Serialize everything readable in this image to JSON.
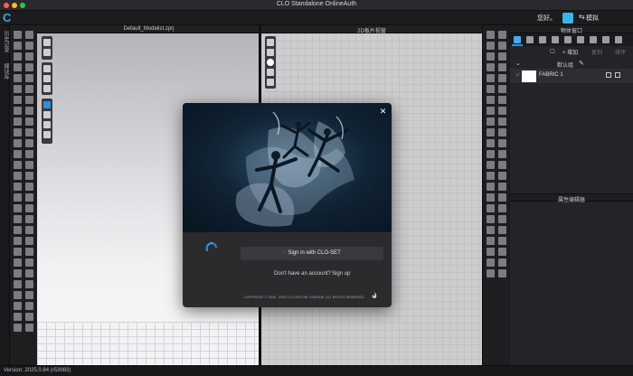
{
  "window": {
    "title": "CLO Standalone OnlineAuth"
  },
  "menubar": {
    "greeting": "您好。",
    "mode": "模拟"
  },
  "left_strip": {
    "tabs": [
      "历史记录",
      "模块库"
    ]
  },
  "viewport_3d": {
    "title": "Default_Modelist.zprj"
  },
  "viewport_2d": {
    "title": "2D板片视窗"
  },
  "object_browser": {
    "title": "物体窗口",
    "add_label": "+ 增加",
    "copy_label": "复制",
    "sort_label": "排序",
    "group_label": "默认组",
    "fabric_name": "FABRIC 1"
  },
  "property_editor": {
    "title": "属性编辑器"
  },
  "dialog": {
    "signin_label": "Sign in with CLO-SET",
    "no_account_text": "Don't have an account?",
    "signup_label": "Sign up",
    "copyright": "COPYRIGHT © 2006 - 2025 CLO VIRTUAL FASHION. ALL RIGHTS RESERVED."
  },
  "status": {
    "version": "Version: 2025.0.84 (r53983)"
  },
  "colors": {
    "accent": "#2b8fe0",
    "app_bg": "#1b1b1e",
    "dialog_bg": "#2b2b2e",
    "logo": "#39a6e9"
  }
}
